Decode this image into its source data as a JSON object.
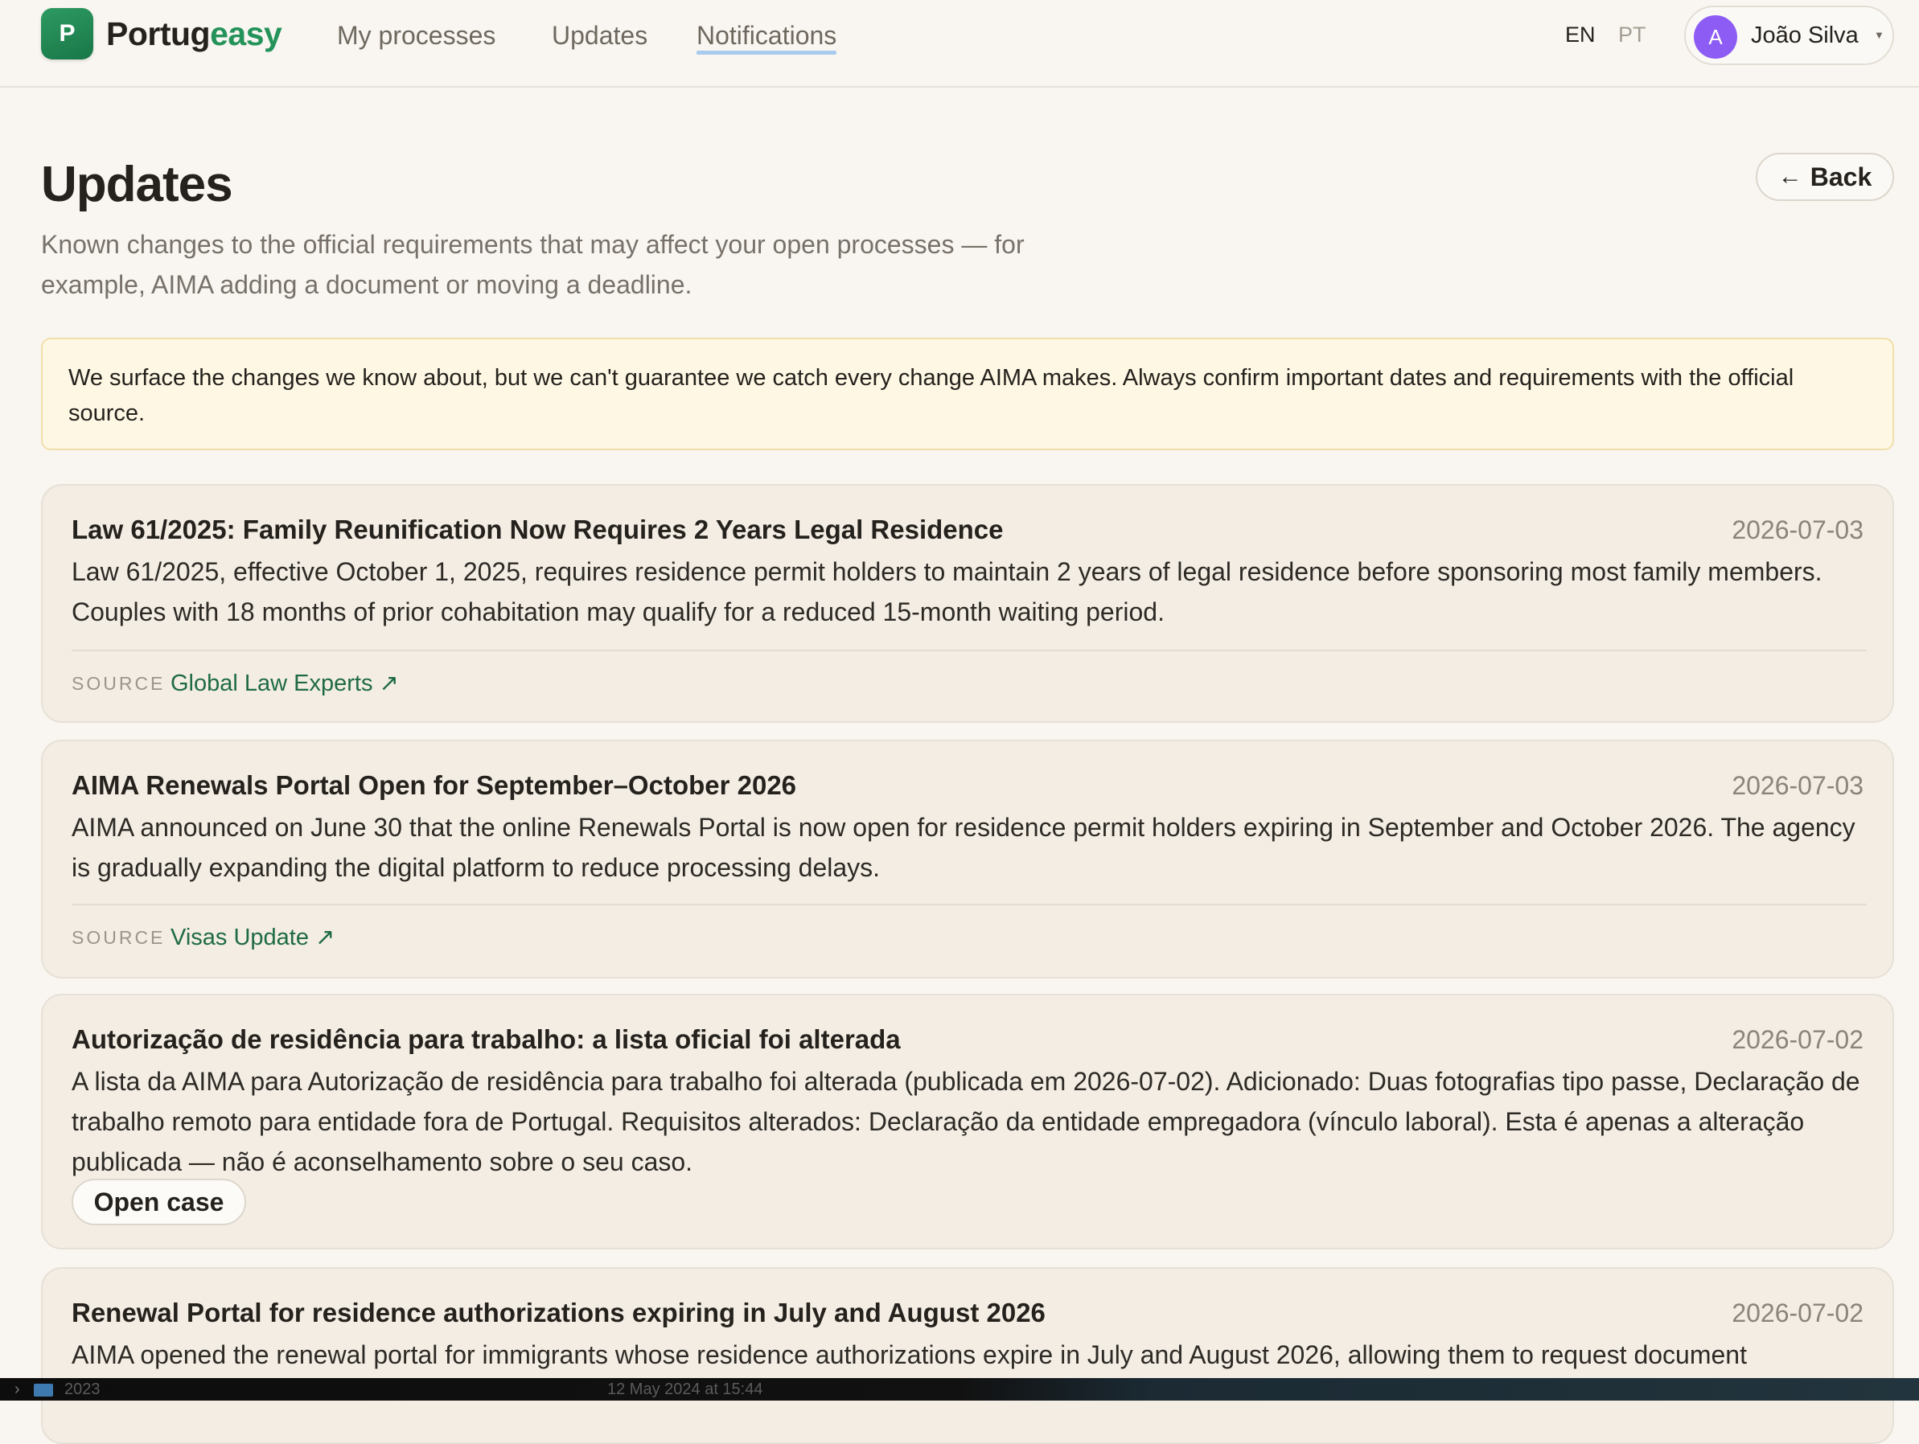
{
  "app": {
    "logo_letter": "P",
    "brand_part1": "Portug",
    "brand_part2": "easy",
    "brand_color": "#24935a"
  },
  "nav": {
    "items": [
      {
        "label": "My processes",
        "active": false
      },
      {
        "label": "Updates",
        "active": false
      },
      {
        "label": "Notifications",
        "active": true
      }
    ]
  },
  "language": {
    "options": [
      "EN",
      "PT"
    ],
    "selected": "EN"
  },
  "user": {
    "avatar_initial": "A",
    "name": "João Silva",
    "caret_icon": "chevron-down-icon"
  },
  "page": {
    "title": "Updates",
    "back_label": "Back",
    "back_icon": "arrow-left-icon",
    "subtitle": "Known changes to the official requirements that may affect your open processes — for example, AIMA adding a document or moving a deadline."
  },
  "disclaimer": "We surface the changes we know about, but we can't guarantee we catch every change AIMA makes. Always confirm important dates and requirements with the official source.",
  "updates": [
    {
      "title": "Law 61/2025: Family Reunification Now Requires 2 Years Legal Residence",
      "date": "2026-07-03",
      "body": "Law 61/2025, effective October 1, 2025, requires residence permit holders to maintain 2 years of legal residence before sponsoring most family members. Couples with 18 months of prior cohabitation may qualify for a reduced 15-month waiting period.",
      "source_label": "SOURCE",
      "source_name": "Global Law Experts ↗"
    },
    {
      "title": "AIMA Renewals Portal Open for September–October 2026",
      "date": "2026-07-03",
      "body": "AIMA announced on June 30 that the online Renewals Portal is now open for residence permit holders expiring in September and October 2026. The agency is gradually expanding the digital platform to reduce processing delays.",
      "source_label": "SOURCE",
      "source_name": "Visas Update ↗"
    },
    {
      "title": "Autorização de residência para trabalho: a lista oficial foi alterada",
      "date": "2026-07-02",
      "body": "A lista da AIMA para Autorização de residência para trabalho foi alterada (publicada em 2026-07-02). Adicionado: Duas fotografias tipo passe, Declaração de trabalho remoto para entidade fora de Portugal. Requisitos alterados: Declaração da entidade empregadora (vínculo laboral). Esta é apenas a alteração publicada — não é aconselhamento sobre o seu caso.",
      "action_label": "Open case"
    },
    {
      "title": "Renewal Portal for residence authorizations expiring in July and August 2026",
      "date": "2026-07-02",
      "body": "AIMA opened the renewal portal for immigrants whose residence authorizations expire in July and August 2026, allowing them to request document"
    }
  ],
  "taskbar": {
    "folder_name": "2023",
    "datetime": "12 May 2024 at 15:44"
  }
}
